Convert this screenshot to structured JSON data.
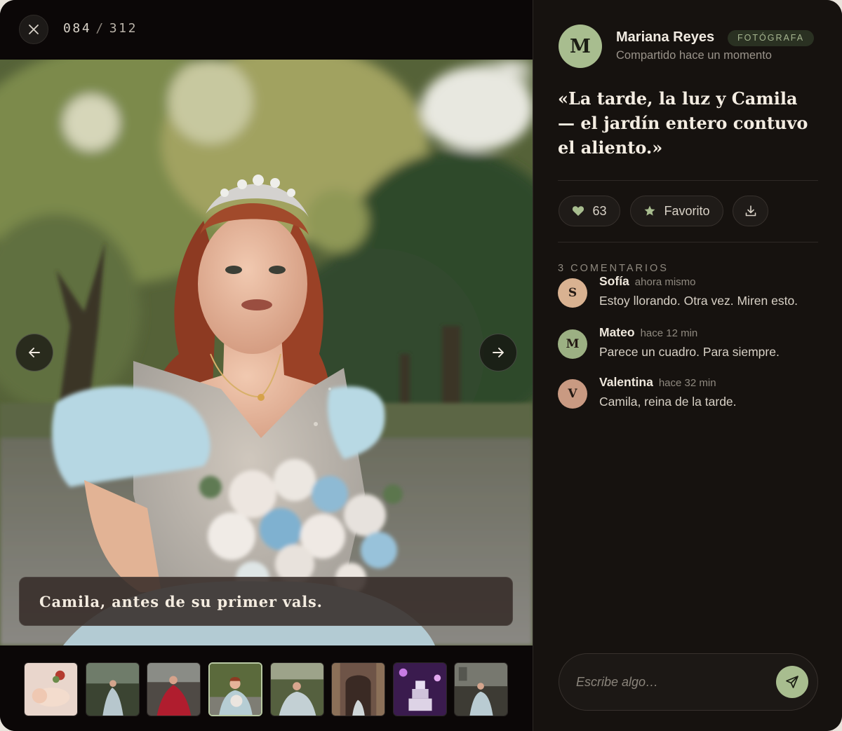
{
  "viewer": {
    "counter_current": "084",
    "counter_separator": "/",
    "counter_total": "312",
    "caption": "Camila, antes de su primer vals.",
    "thumbnails": [
      {
        "alt": "baby-portrait"
      },
      {
        "alt": "gown-garden"
      },
      {
        "alt": "red-dress"
      },
      {
        "alt": "camila-bouquet",
        "active": true
      },
      {
        "alt": "gown-tree"
      },
      {
        "alt": "church-arch"
      },
      {
        "alt": "cake-purple"
      },
      {
        "alt": "gown-building"
      }
    ]
  },
  "author": {
    "initial": "M",
    "name": "Mariana Reyes",
    "role": "FOTÓGRAFA",
    "shared": "Compartido hace un momento"
  },
  "post": {
    "quote_line1": "«La tarde, la luz y Camila",
    "quote_line2": "— el jardín entero contuvo",
    "quote_line3": "el aliento.»"
  },
  "actions": {
    "likes": "63",
    "favorite_label": "Favorito"
  },
  "comments": {
    "heading": "3 COMENTARIOS",
    "items": [
      {
        "initial": "S",
        "name": "Sofía",
        "time": "ahora mismo",
        "text": "Estoy llorando. Otra vez. Miren esto."
      },
      {
        "initial": "M",
        "name": "Mateo",
        "time": "hace 12 min",
        "text": "Parece un cuadro. Para siempre."
      },
      {
        "initial": "V",
        "name": "Valentina",
        "time": "hace 32 min",
        "text": "Camila, reina de la tarde."
      }
    ]
  },
  "composer": {
    "placeholder": "Escribe algo…"
  },
  "colors": {
    "accent": "#a8bd8f",
    "panel_bg": "#16120f",
    "avatar_sofia": "#d9b291",
    "avatar_mateo": "#9cb083",
    "avatar_valentina": "#c99a82"
  },
  "icons": [
    "close-icon",
    "arrow-left-icon",
    "arrow-right-icon",
    "heart-icon",
    "star-icon",
    "download-icon",
    "send-icon"
  ]
}
